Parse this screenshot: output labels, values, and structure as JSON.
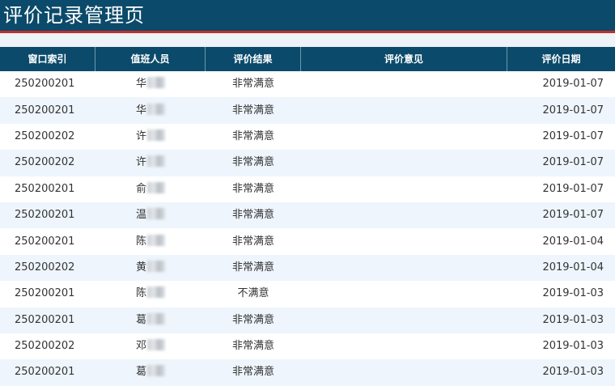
{
  "page": {
    "title": "评价记录管理页"
  },
  "table": {
    "headers": [
      "窗口索引",
      "值班人员",
      "评价结果",
      "评价意见",
      "评价日期"
    ],
    "rows": [
      {
        "window": "250200201",
        "staff": "华",
        "result": "非常满意",
        "comment": "",
        "date": "2019-01-07"
      },
      {
        "window": "250200201",
        "staff": "华",
        "result": "非常满意",
        "comment": "",
        "date": "2019-01-07"
      },
      {
        "window": "250200202",
        "staff": "许",
        "result": "非常满意",
        "comment": "",
        "date": "2019-01-07"
      },
      {
        "window": "250200202",
        "staff": "许",
        "result": "非常满意",
        "comment": "",
        "date": "2019-01-07"
      },
      {
        "window": "250200201",
        "staff": "俞",
        "result": "非常满意",
        "comment": "",
        "date": "2019-01-07"
      },
      {
        "window": "250200201",
        "staff": "温",
        "result": "非常满意",
        "comment": "",
        "date": "2019-01-07"
      },
      {
        "window": "250200201",
        "staff": "陈",
        "result": "非常满意",
        "comment": "",
        "date": "2019-01-04"
      },
      {
        "window": "250200202",
        "staff": "黄",
        "result": "非常满意",
        "comment": "",
        "date": "2019-01-04"
      },
      {
        "window": "250200201",
        "staff": "陈",
        "result": "不满意",
        "comment": "",
        "date": "2019-01-03"
      },
      {
        "window": "250200201",
        "staff": "葛",
        "result": "非常满意",
        "comment": "",
        "date": "2019-01-03"
      },
      {
        "window": "250200202",
        "staff": "邓",
        "result": "非常满意",
        "comment": "",
        "date": "2019-01-03"
      },
      {
        "window": "250200201",
        "staff": "葛",
        "result": "非常满意",
        "comment": "",
        "date": "2019-01-03"
      }
    ]
  },
  "colors": {
    "header_bg": "#0b4a6a",
    "accent_line": "#c0302b",
    "row_alt": "#eef5fc"
  }
}
